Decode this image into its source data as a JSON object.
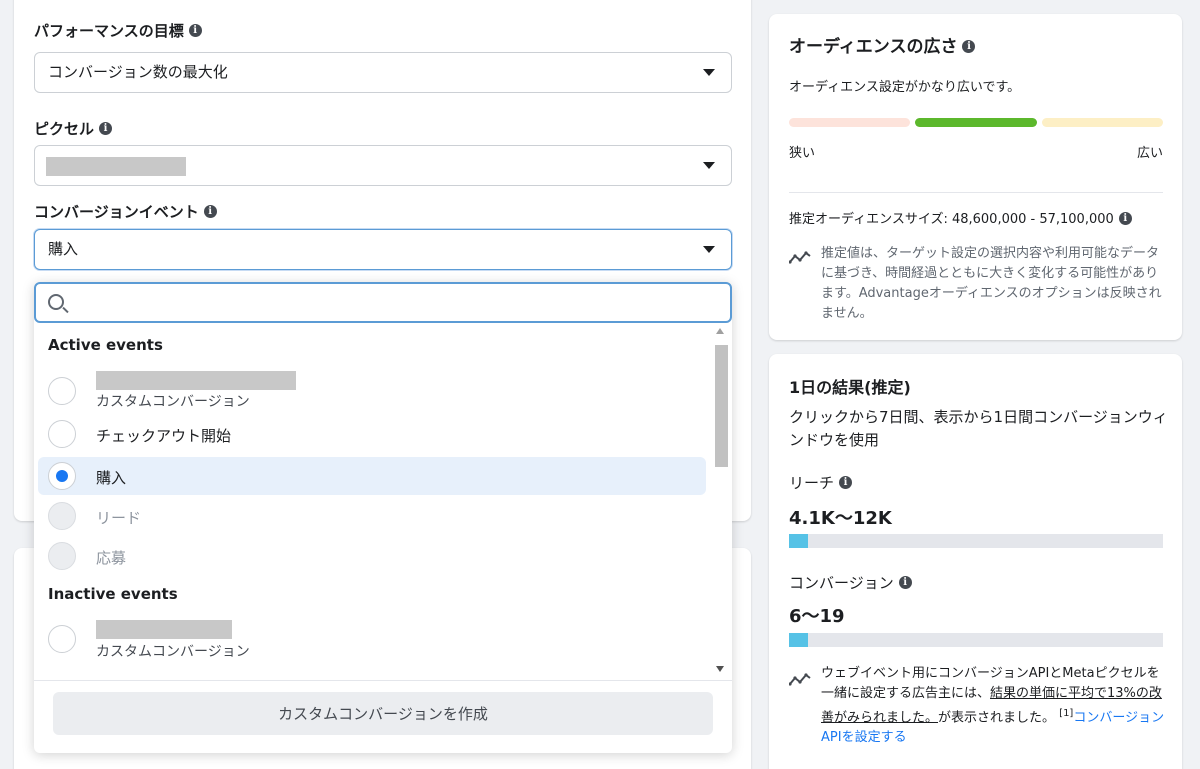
{
  "form": {
    "performance_goal": {
      "label": "パフォーマンスの目標",
      "value": "コンバージョン数の最大化"
    },
    "pixel": {
      "label": "ピクセル"
    },
    "conversion_event": {
      "label": "コンバージョンイベント",
      "value": "購入"
    }
  },
  "dropdown": {
    "search_placeholder": "",
    "active_title": "Active events",
    "inactive_title": "Inactive events",
    "active_options": [
      {
        "label": "",
        "sublabel": "カスタムコンバージョン",
        "checked": false,
        "disabled": false
      },
      {
        "label": "チェックアウト開始",
        "checked": false,
        "disabled": false
      },
      {
        "label": "購入",
        "checked": true,
        "disabled": false
      },
      {
        "label": "リード",
        "checked": false,
        "disabled": true
      },
      {
        "label": "応募",
        "checked": false,
        "disabled": true
      }
    ],
    "inactive_options": [
      {
        "label": "",
        "sublabel": "カスタムコンバージョン",
        "checked": false,
        "disabled": false
      }
    ],
    "create_button": "カスタムコンバージョンを作成"
  },
  "audience": {
    "title": "オーディエンスの広さ",
    "description": "オーディエンス設定がかなり広いです。",
    "narrow_label": "狭い",
    "wide_label": "広い",
    "meter_colors": {
      "narrow": "#fde3db",
      "active": "#5cb82c",
      "wide": "#fdefc5"
    },
    "size_label": "推定オーディエンスサイズ: 48,600,000 - 57,100,000",
    "note": "推定値は、ターゲット設定の選択内容や利用可能なデータに基づき、時間経過とともに大きく変化する可能性があります。Advantageオーディエンスのオプションは反映されません。"
  },
  "results": {
    "title": "1日の結果(推定)",
    "description": "クリックから7日間、表示から1日間コンバージョンウィンドウを使用",
    "reach": {
      "label": "リーチ",
      "value": "4.1K〜12K",
      "fill": 0.05
    },
    "conversions": {
      "label": "コンバージョン",
      "value": "6〜19",
      "fill": 0.05
    },
    "note_part1": "ウェブイベント用にコンバージョンAPIとMetaピクセルを一緒に設定する広告主には、",
    "note_underline": "結果の単価に平均で13%の改善がみられました。",
    "note_part2": "が表示されました。",
    "note_ref": "[1]",
    "note_link": "コンバージョンAPIを設定する",
    "bar_color": "#56c2e6"
  }
}
